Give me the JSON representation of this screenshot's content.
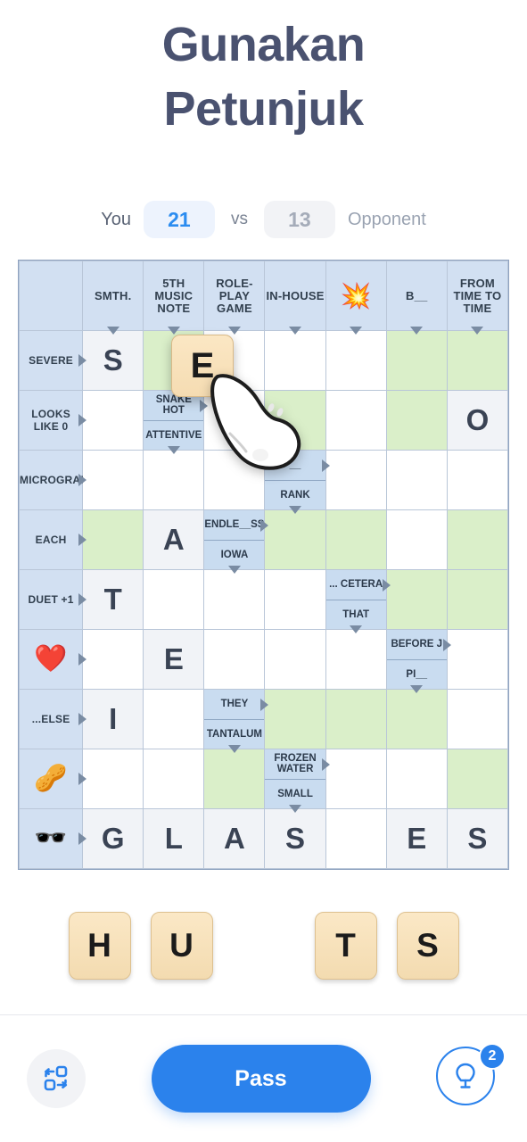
{
  "header": {
    "title_line1": "Gunakan",
    "title_line2": "Petunjuk"
  },
  "score": {
    "you_label": "You",
    "you_value": "21",
    "vs_label": "vs",
    "opponent_value": "13",
    "opponent_label": "Opponent",
    "you_color": "#2b8cf0",
    "opponent_color": "#a5acb9"
  },
  "grid": {
    "corner": "",
    "columns": [
      {
        "label": "SMTH.",
        "type": "text"
      },
      {
        "label": "5TH MUSIC NOTE",
        "type": "text"
      },
      {
        "label": "ROLE-PLAY GAME",
        "type": "text"
      },
      {
        "label": "IN-HOUSE",
        "type": "text"
      },
      {
        "label": "💥",
        "type": "emoji",
        "name": "oops-emoji"
      },
      {
        "label": "B__",
        "type": "text"
      },
      {
        "label": "FROM TIME TO TIME",
        "type": "text"
      }
    ],
    "rows": [
      {
        "header": {
          "label": "SEVERE",
          "type": "text"
        },
        "cells": [
          {
            "kind": "letter",
            "value": "S"
          },
          {
            "kind": "green"
          },
          {
            "kind": "empty"
          },
          {
            "kind": "empty"
          },
          {
            "kind": "empty"
          },
          {
            "kind": "green"
          },
          {
            "kind": "green"
          }
        ]
      },
      {
        "header": {
          "label": "LOOKS LIKE 0",
          "type": "text"
        },
        "cells": [
          {
            "kind": "empty"
          },
          {
            "kind": "clue",
            "top": "SNAKE HOT",
            "bottom": "ATTENTIVE",
            "arrow_right_top": true,
            "arrow_down_bottom": true
          },
          {
            "kind": "empty"
          },
          {
            "kind": "green"
          },
          {
            "kind": "empty"
          },
          {
            "kind": "green"
          },
          {
            "kind": "letter",
            "value": "O"
          }
        ]
      },
      {
        "header": {
          "label": "MICROGRAM",
          "type": "text"
        },
        "cells": [
          {
            "kind": "empty"
          },
          {
            "kind": "empty"
          },
          {
            "kind": "empty"
          },
          {
            "kind": "clue",
            "top": "__",
            "bottom": "RANK",
            "arrow_right_top": true,
            "arrow_down_bottom": true
          },
          {
            "kind": "empty"
          },
          {
            "kind": "empty"
          },
          {
            "kind": "empty"
          }
        ]
      },
      {
        "header": {
          "label": "EACH",
          "type": "text"
        },
        "cells": [
          {
            "kind": "green"
          },
          {
            "kind": "letter",
            "value": "A"
          },
          {
            "kind": "clue",
            "top": "ENDLE__SS",
            "bottom": "IOWA",
            "arrow_right_top": true,
            "arrow_down_bottom": true
          },
          {
            "kind": "green"
          },
          {
            "kind": "green"
          },
          {
            "kind": "empty"
          },
          {
            "kind": "green"
          }
        ]
      },
      {
        "header": {
          "label": "DUET +1",
          "type": "text"
        },
        "cells": [
          {
            "kind": "letter",
            "value": "T"
          },
          {
            "kind": "empty"
          },
          {
            "kind": "empty"
          },
          {
            "kind": "empty"
          },
          {
            "kind": "clue",
            "top": "... CETERA",
            "bottom": "THAT",
            "arrow_right_top": true,
            "arrow_down_bottom": true
          },
          {
            "kind": "green"
          },
          {
            "kind": "green"
          }
        ]
      },
      {
        "header": {
          "label": "❤️",
          "type": "emoji",
          "name": "heart-emoji"
        },
        "cells": [
          {
            "kind": "empty"
          },
          {
            "kind": "letter",
            "value": "E"
          },
          {
            "kind": "empty"
          },
          {
            "kind": "empty"
          },
          {
            "kind": "empty"
          },
          {
            "kind": "clue",
            "top": "BEFORE J",
            "bottom": "PI__",
            "arrow_right_top": true,
            "arrow_down_bottom": true
          },
          {
            "kind": "empty"
          }
        ]
      },
      {
        "header": {
          "label": "...ELSE",
          "type": "text"
        },
        "cells": [
          {
            "kind": "letter",
            "value": "I"
          },
          {
            "kind": "empty"
          },
          {
            "kind": "clue",
            "top": "THEY",
            "bottom": "TANTALUM",
            "arrow_right_top": true,
            "arrow_down_bottom": true
          },
          {
            "kind": "green"
          },
          {
            "kind": "green"
          },
          {
            "kind": "green"
          },
          {
            "kind": "empty"
          }
        ]
      },
      {
        "header": {
          "label": "🥜",
          "type": "emoji",
          "name": "walnut-emoji"
        },
        "cells": [
          {
            "kind": "empty"
          },
          {
            "kind": "empty"
          },
          {
            "kind": "green"
          },
          {
            "kind": "clue",
            "top": "FROZEN WATER",
            "bottom": "SMALL",
            "arrow_right_top": true,
            "arrow_down_bottom": true
          },
          {
            "kind": "empty"
          },
          {
            "kind": "empty"
          },
          {
            "kind": "green"
          }
        ]
      },
      {
        "header": {
          "label": "🕶️",
          "type": "emoji",
          "name": "sunglasses-emoji"
        },
        "cells": [
          {
            "kind": "letter",
            "value": "G"
          },
          {
            "kind": "letter",
            "value": "L"
          },
          {
            "kind": "letter",
            "value": "A"
          },
          {
            "kind": "letter",
            "value": "S"
          },
          {
            "kind": "empty"
          },
          {
            "kind": "letter",
            "value": "E"
          },
          {
            "kind": "letter",
            "value": "S"
          }
        ]
      }
    ],
    "colors": {
      "header_blue": "#d2e0f2",
      "clue_blue": "#c9dcf0",
      "highlight_green": "#daefc9",
      "letter_bg": "#f1f3f7",
      "border": "#b9c6d8",
      "arrow": "#7a8ca3"
    }
  },
  "drag": {
    "tile_letter": "E"
  },
  "rack": {
    "tiles": [
      {
        "letter": "H",
        "empty": false
      },
      {
        "letter": "U",
        "empty": false
      },
      {
        "letter": "",
        "empty": true
      },
      {
        "letter": "T",
        "empty": false
      },
      {
        "letter": "S",
        "empty": false
      }
    ]
  },
  "bottombar": {
    "shuffle_label": "shuffle-icon",
    "pass_label": "Pass",
    "hint_label": "hint-icon",
    "hint_count": "2",
    "accent_color": "#2b82ec"
  }
}
